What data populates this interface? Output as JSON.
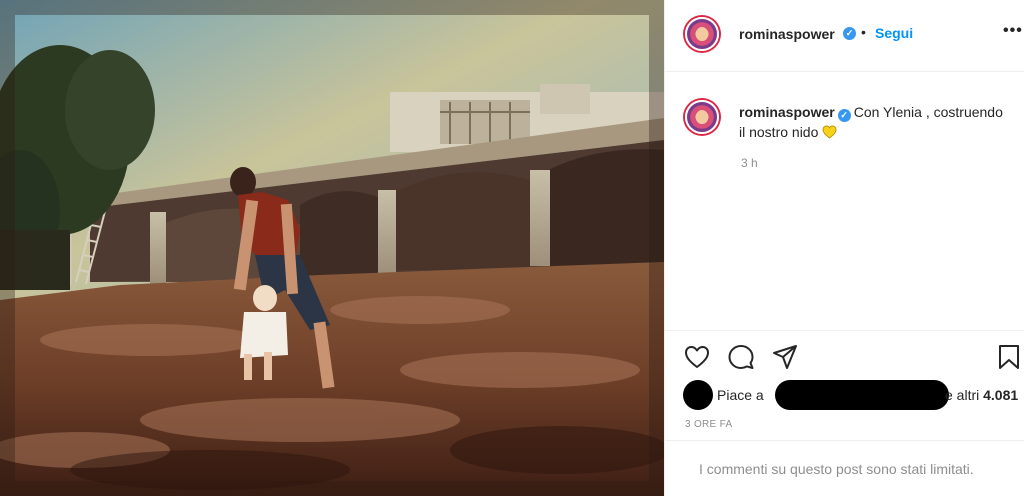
{
  "post": {
    "photo_label": "post-photo",
    "author": {
      "username": "rominaspower",
      "verified_mark": "✓",
      "dot": "•",
      "follow_label": "Segui",
      "more_label": "•••"
    },
    "caption": {
      "username": "rominaspower",
      "text": "Con Ylenia , costruendo il nostro nido",
      "emoji": "yellow-heart-icon",
      "time": "3 h"
    },
    "actions": {
      "like_icon": "heart-icon",
      "comment_icon": "comment-icon",
      "share_icon": "share-icon",
      "save_icon": "bookmark-icon"
    },
    "likes": {
      "prefix": "Piace a",
      "suffix_and": "e altri",
      "count": "4.081"
    },
    "timestamp": "3 ORE FA",
    "comments_notice": "I commenti su questo post sono stati limitati."
  },
  "colors": {
    "link": "#0095f6",
    "verified": "#3897f0",
    "muted": "#8e8e8e",
    "heart_yellow": "#f7d21b"
  }
}
